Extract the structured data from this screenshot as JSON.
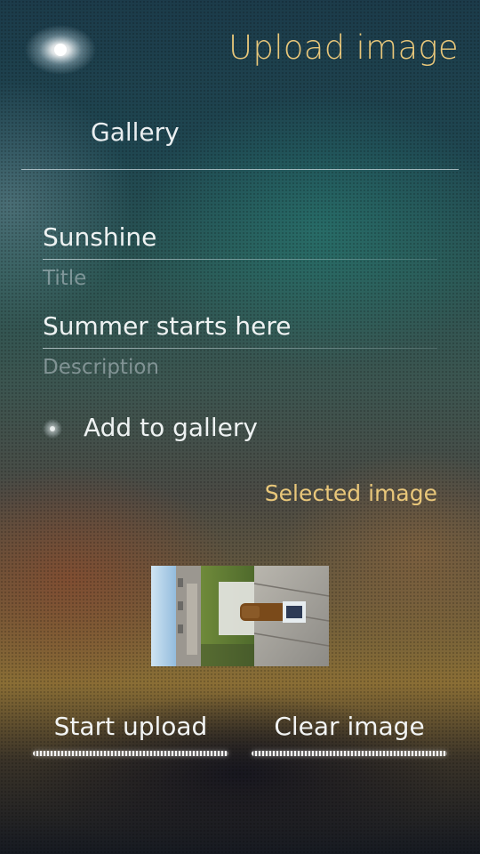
{
  "header": {
    "title": "Upload image",
    "title_color": "#e9c77a"
  },
  "combo": {
    "value": "Gallery"
  },
  "fields": {
    "title": {
      "value": "Sunshine",
      "label": "Title"
    },
    "description": {
      "value": "Summer starts here",
      "label": "Description"
    }
  },
  "gallery_switch": {
    "label": "Add to gallery",
    "checked": false
  },
  "selected_image": {
    "header": "Selected image",
    "icon": "image-thumbnail"
  },
  "buttons": {
    "start_upload": "Start upload",
    "clear_image": "Clear image"
  },
  "icons": {
    "pulley_menu": "pulley-menu-indicator-icon",
    "switch": "switch-indicator-icon"
  },
  "colors": {
    "accent": "#e9c77a",
    "text": "#eef2f2",
    "secondary": "#bcc8cd"
  }
}
